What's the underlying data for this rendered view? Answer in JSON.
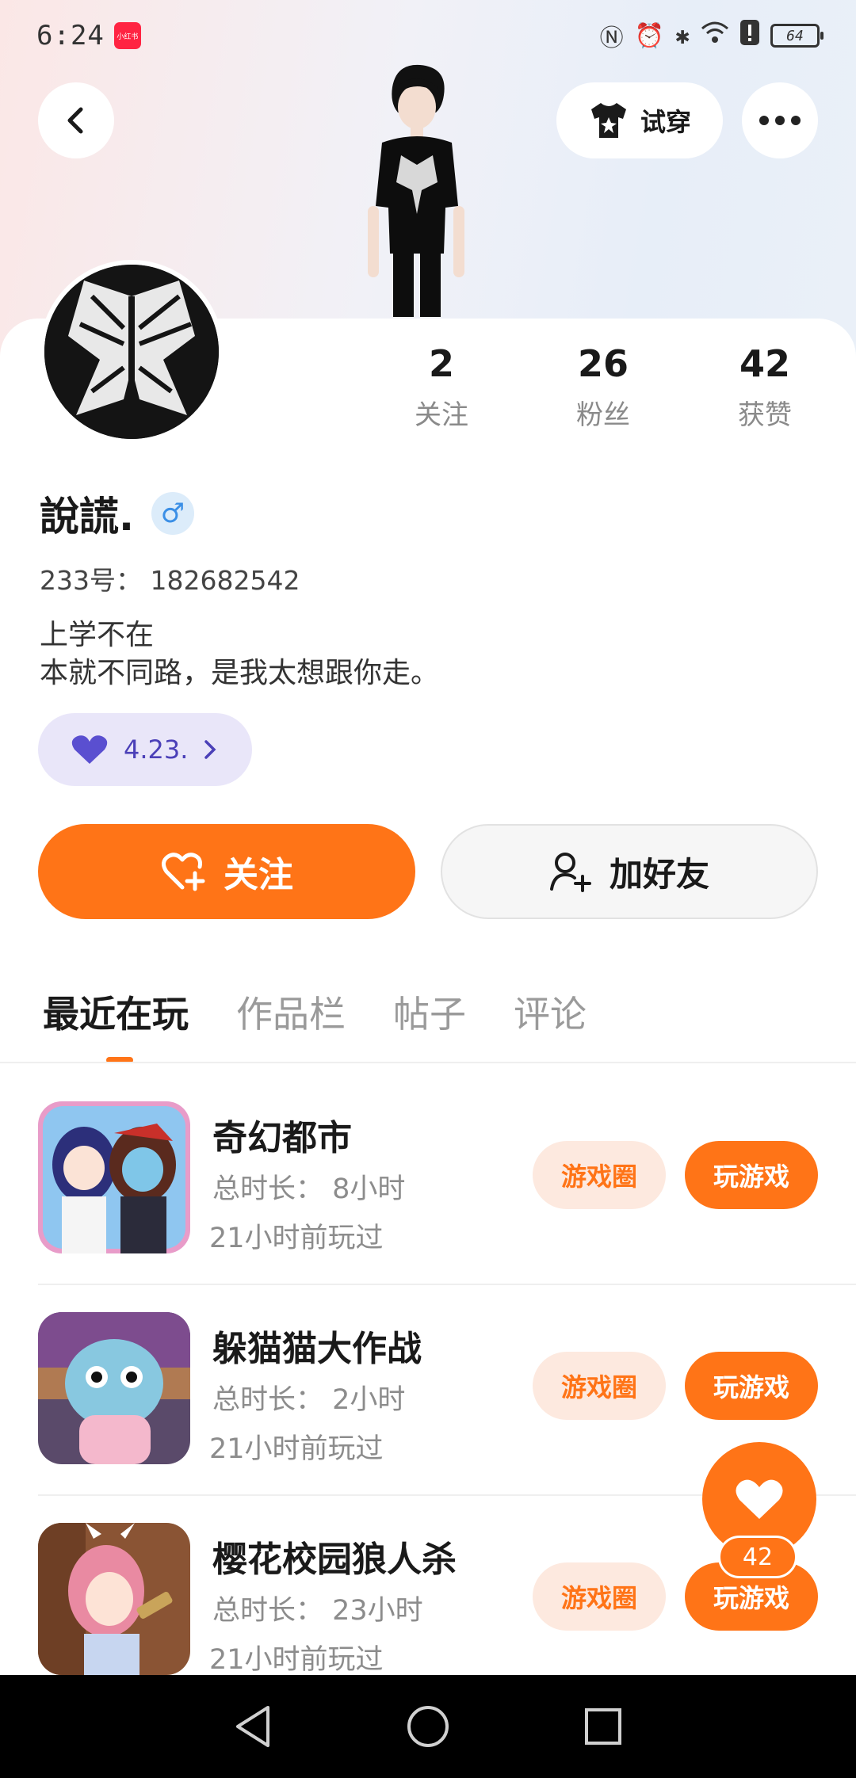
{
  "status_bar": {
    "time": "6:24",
    "app_badge": "小红书",
    "battery": "64"
  },
  "header": {
    "tryon_label": "试穿"
  },
  "profile": {
    "stats": [
      {
        "value": "2",
        "label": "关注"
      },
      {
        "value": "26",
        "label": "粉丝"
      },
      {
        "value": "42",
        "label": "获赞"
      }
    ],
    "nickname": "說謊.",
    "gender_symbol": "♂",
    "uid": "233号： 182682542",
    "bio_line1": "上学不在",
    "bio_line2": "本就不同路，是我太想跟你走。",
    "tag": "4.23."
  },
  "actions": {
    "follow_label": "关注",
    "add_friend_label": "加好友"
  },
  "tabs": [
    {
      "label": "最近在玩",
      "active": true
    },
    {
      "label": "作品栏",
      "active": false
    },
    {
      "label": "帖子",
      "active": false
    },
    {
      "label": "评论",
      "active": false
    }
  ],
  "games": [
    {
      "title": "奇幻都市",
      "duration": "总时长： 8小时",
      "last_played": "21小时前玩过",
      "circle_label": "游戏圈",
      "play_label": "玩游戏"
    },
    {
      "title": "躲猫猫大作战",
      "duration": "总时长： 2小时",
      "last_played": "21小时前玩过",
      "circle_label": "游戏圈",
      "play_label": "玩游戏"
    },
    {
      "title": "樱花校园狼人杀",
      "duration": "总时长： 23小时",
      "last_played": "21小时前玩过",
      "circle_label": "游戏圈",
      "play_label": "玩游戏"
    }
  ],
  "like_fab": {
    "count": "42"
  },
  "colors": {
    "accent": "#ff7417",
    "tag_bg": "#e9e6f9",
    "tag_fg": "#4b40b8"
  }
}
